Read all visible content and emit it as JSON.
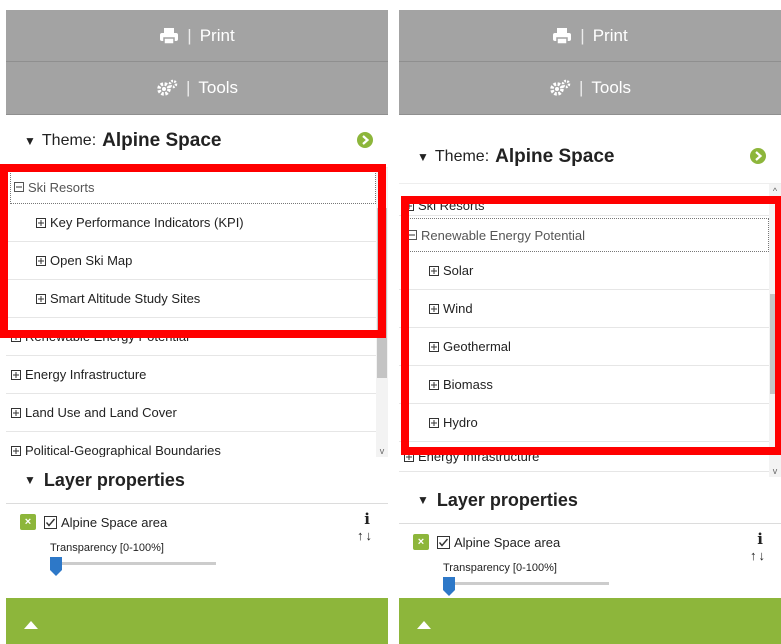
{
  "panels": [
    {
      "print": {
        "label": "Print",
        "icon": "printer-icon"
      },
      "tools": {
        "label": "Tools",
        "icon": "gears-icon"
      },
      "theme": {
        "prefix": "Theme:",
        "name": "Alpine Space"
      },
      "tree": [
        {
          "label": "Ski Resorts",
          "level": 0,
          "state": "expanded"
        },
        {
          "label": "Key Performance Indicators (KPI)",
          "level": 1,
          "state": "collapsed"
        },
        {
          "label": "Open Ski Map",
          "level": 1,
          "state": "collapsed"
        },
        {
          "label": "Smart Altitude Study Sites",
          "level": 1,
          "state": "collapsed"
        },
        {
          "label": "Renewable Energy Potential",
          "level": 0,
          "state": "collapsed"
        },
        {
          "label": "Energy Infrastructure",
          "level": 0,
          "state": "collapsed"
        },
        {
          "label": "Land Use and Land Cover",
          "level": 0,
          "state": "collapsed"
        },
        {
          "label": "Political-Geographical Boundaries",
          "level": 0,
          "state": "collapsed"
        }
      ],
      "scroll_position": 0.1,
      "layer_properties": {
        "title": "Layer properties",
        "layer_name": "Alpine Space area",
        "layer_checked": true,
        "transparency_label": "Transparency [0-100%]",
        "transparency_value": 0
      }
    },
    {
      "print": {
        "label": "Print",
        "icon": "printer-icon"
      },
      "tools": {
        "label": "Tools",
        "icon": "gears-icon"
      },
      "theme": {
        "prefix": "Theme:",
        "name": "Alpine Space"
      },
      "tree": [
        {
          "label": "Ski Resorts",
          "level": 0,
          "state": "collapsed"
        },
        {
          "label": "Renewable Energy Potential",
          "level": 0,
          "state": "expanded"
        },
        {
          "label": "Solar",
          "level": 1,
          "state": "collapsed"
        },
        {
          "label": "Wind",
          "level": 1,
          "state": "collapsed"
        },
        {
          "label": "Geothermal",
          "level": 1,
          "state": "collapsed"
        },
        {
          "label": "Biomass",
          "level": 1,
          "state": "collapsed"
        },
        {
          "label": "Hydro",
          "level": 1,
          "state": "collapsed"
        },
        {
          "label": "Energy Infrastructure",
          "level": 0,
          "state": "collapsed"
        }
      ],
      "scroll_position": 0.3,
      "layer_properties": {
        "title": "Layer properties",
        "layer_name": "Alpine Space area",
        "layer_checked": true,
        "transparency_label": "Transparency [0-100%]",
        "transparency_value": 0
      }
    }
  ],
  "colors": {
    "header_gray": "#a3a3a3",
    "accent_green": "#8db63b",
    "highlight_red": "#ff0000"
  }
}
